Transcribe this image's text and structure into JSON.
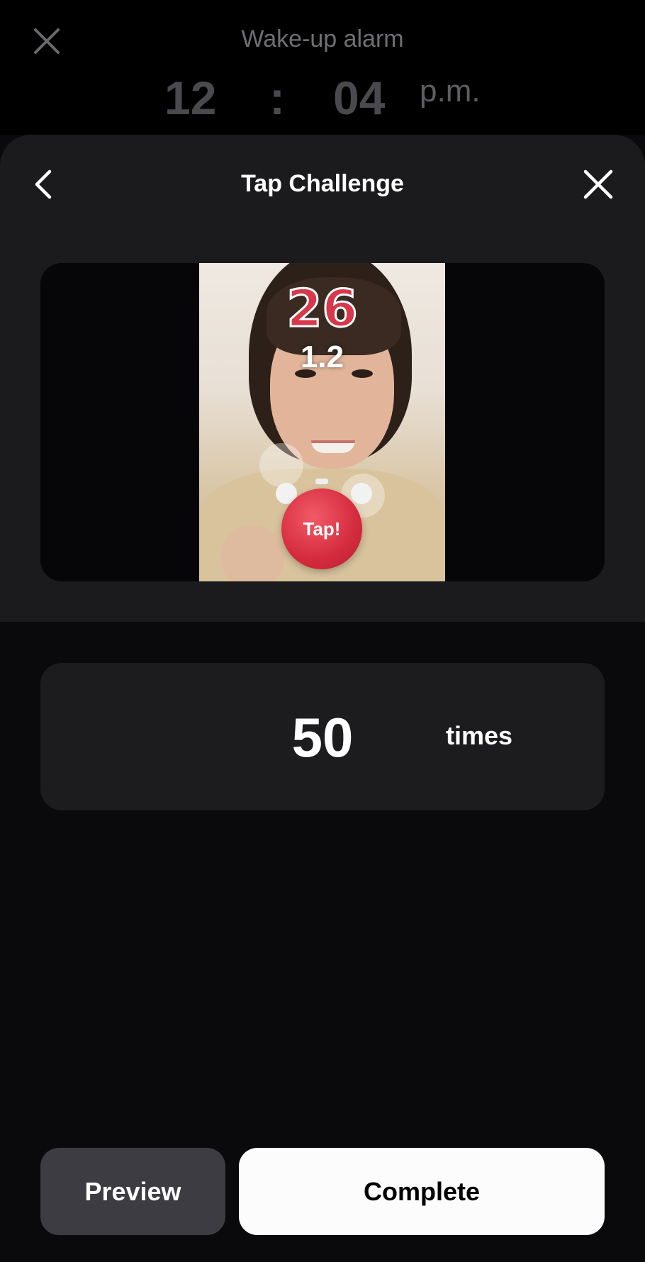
{
  "background": {
    "title": "Wake-up alarm",
    "hour": "12",
    "colon": ":",
    "minute": "04",
    "ampm": "p.m."
  },
  "sheet": {
    "title": "Tap Challenge",
    "back_icon": "chevron-left-icon",
    "close_icon": "close-icon"
  },
  "preview_video": {
    "count": "26",
    "timer": "1.2",
    "tap_label": "Tap!"
  },
  "taps": {
    "value": "50",
    "unit": "times"
  },
  "footer": {
    "preview_label": "Preview",
    "complete_label": "Complete"
  },
  "colors": {
    "sheet_bg": "#1b1b1e",
    "page_bg": "#0a0a0c",
    "tap_red": "#d42b3e",
    "preview_button": "#3d3c42",
    "complete_button": "#fcfcfc"
  }
}
